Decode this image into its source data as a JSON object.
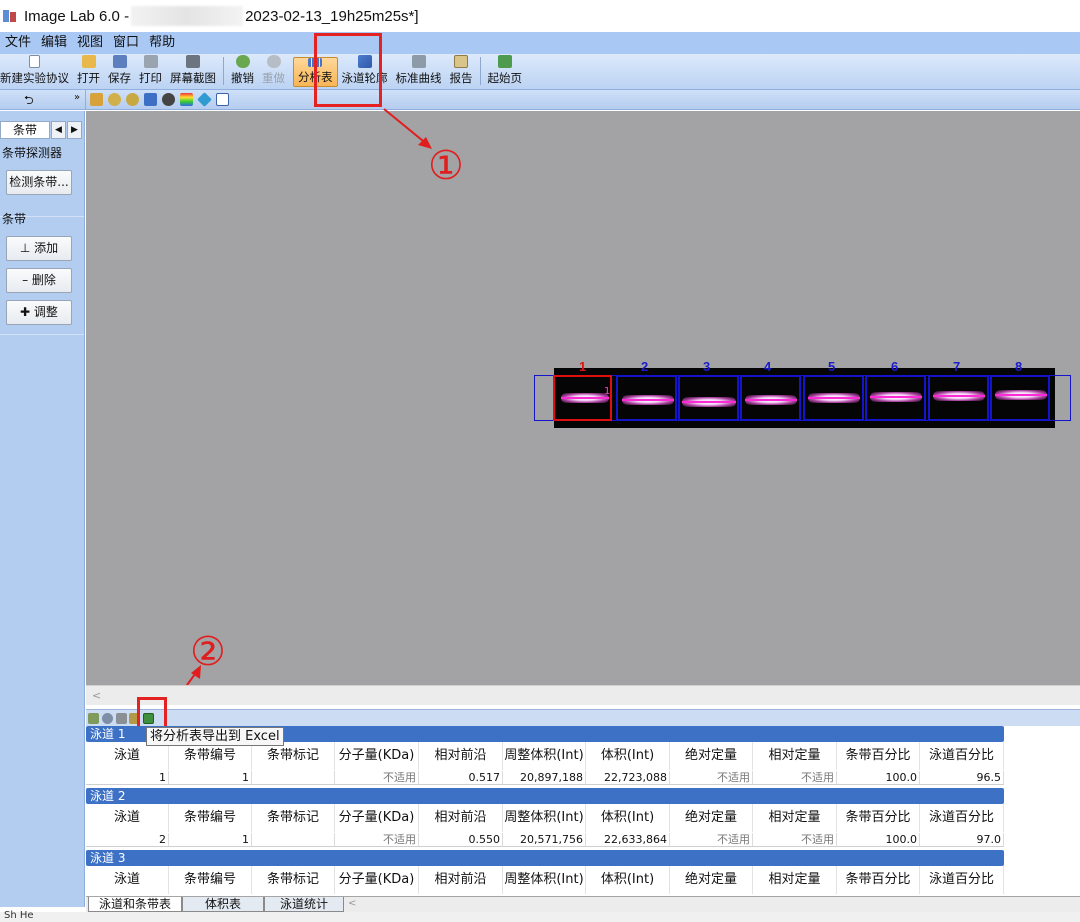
{
  "window": {
    "title_prefix": "Image Lab 6.0 - ",
    "title_suffix": "2023-02-13_19h25m25s*]"
  },
  "menu": [
    "文件",
    "编辑",
    "视图",
    "窗口",
    "帮助"
  ],
  "toolbar": {
    "new_protocol": "新建实验协议",
    "open": "打开",
    "save": "保存",
    "print": "打印",
    "screenshot": "屏幕截图",
    "undo": "撤销",
    "redo": "重做",
    "analysis_table": "分析表",
    "lane_profile": "泳道轮廓",
    "standard_curve": "标准曲线",
    "report": "报告",
    "start_page": "起始页"
  },
  "left_panel": {
    "tab": "条带",
    "band_detector_title": "条带探测器",
    "detect_button": "检测条带...",
    "bands_title": "条带",
    "add": "添加",
    "delete": "删除",
    "adjust": "调整"
  },
  "gel": {
    "lane_numbers": [
      "1",
      "2",
      "3",
      "4",
      "5",
      "6",
      "7",
      "8"
    ],
    "selected_lane": "1",
    "band_marker": "1"
  },
  "annotations": {
    "step1": "①",
    "step2": "②"
  },
  "tooltip": "将分析表导出到 Excel",
  "table": {
    "columns": [
      "泳道",
      "条带编号",
      "条带标记",
      "分子量(KDa)",
      "相对前沿",
      "周整体积(Int)",
      "体积(Int)",
      "绝对定量",
      "相对定量",
      "条带百分比",
      "泳道百分比"
    ],
    "lanes": [
      {
        "header": "泳道 1",
        "row": [
          "1",
          "1",
          "",
          "不适用",
          "0.517",
          "20,897,188",
          "22,723,088",
          "不适用",
          "不适用",
          "100.0",
          "96.5"
        ]
      },
      {
        "header": "泳道 2",
        "row": [
          "2",
          "1",
          "",
          "不适用",
          "0.550",
          "20,571,756",
          "22,633,864",
          "不适用",
          "不适用",
          "100.0",
          "97.0"
        ]
      },
      {
        "header": "泳道 3",
        "row": []
      }
    ]
  },
  "bottom_tabs": [
    "泳道和条带表",
    "体积表",
    "泳道统计"
  ],
  "status_text": "Sh He",
  "colors": {
    "annotation_red": "#e52222",
    "lane_blue": "#1414c8",
    "header_blue": "#3d71c5",
    "menu_bg": "#a9c8f4"
  }
}
